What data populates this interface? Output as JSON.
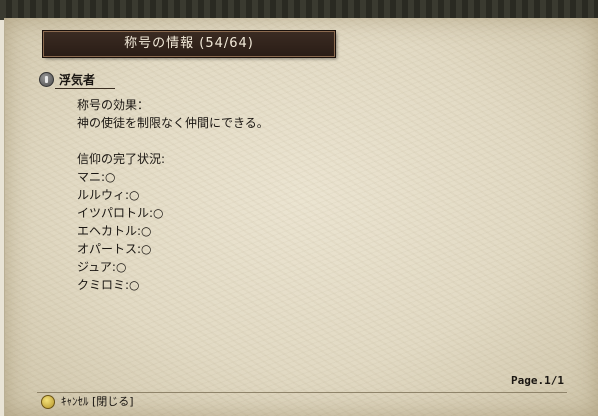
{
  "window": {
    "title": "称号の情報 (54/64)"
  },
  "section": {
    "heading": "浮気者"
  },
  "effect": {
    "label": "称号の効果：",
    "description": "神の使徒を制限なく仲間にできる。"
  },
  "faith": {
    "label": "信仰の完了状況:",
    "items": [
      "マニ:○",
      "ルルウィ:○",
      "イツパロトル:○",
      "エヘカトル:○",
      "オパートス:○",
      "ジュア:○",
      "クミロミ:○"
    ]
  },
  "pagination": {
    "label": "Page.1/1"
  },
  "footer": {
    "hint": "ｷｬﾝｾﾙ [閉じる]"
  },
  "colors": {
    "title_bar": "#2f211a",
    "parchment": "#e4dcc7",
    "text": "#1a1612"
  }
}
